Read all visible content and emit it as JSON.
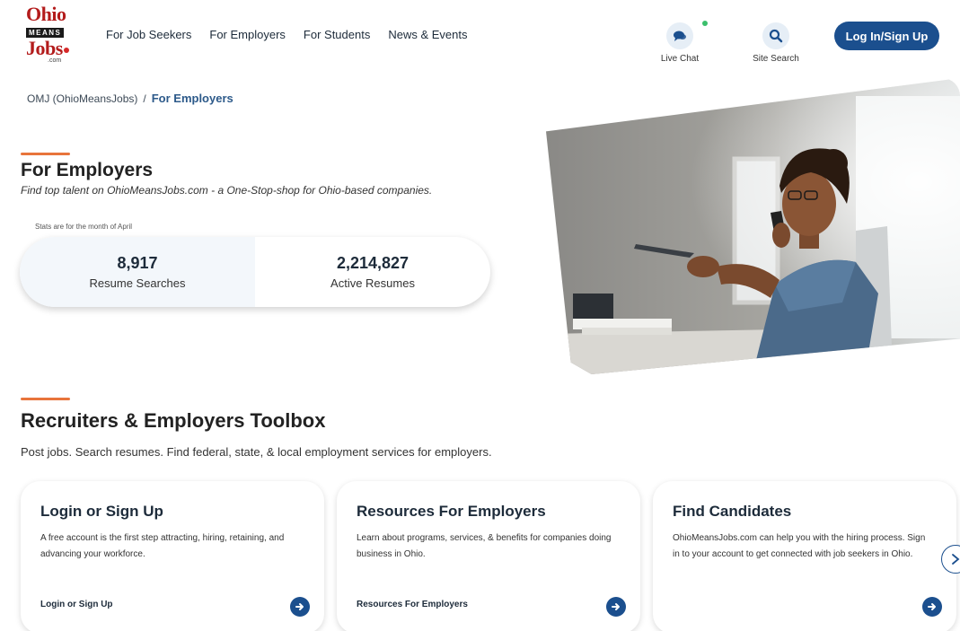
{
  "logo": {
    "line1": "Ohio",
    "line2": "MEANS",
    "line3": "Jobs",
    "line4": ".com"
  },
  "nav": [
    {
      "label": "For Job Seekers"
    },
    {
      "label": "For Employers"
    },
    {
      "label": "For Students"
    },
    {
      "label": "News & Events"
    }
  ],
  "header_tools": {
    "live_chat": {
      "label": "Live Chat",
      "icon": "chat-icon"
    },
    "site_search": {
      "label": "Site Search",
      "icon": "search-icon"
    },
    "login_label": "Log In/Sign Up"
  },
  "breadcrumb": {
    "root": "OMJ (OhioMeansJobs)",
    "separator": "/",
    "current": "For Employers"
  },
  "hero": {
    "title": "For Employers",
    "subtitle": "Find top talent on OhioMeansJobs.com - a One-Stop-shop for Ohio-based companies.",
    "stats_note": "Stats are for the month of April",
    "stats": [
      {
        "value": "8,917",
        "label": "Resume Searches"
      },
      {
        "value": "2,214,827",
        "label": "Active Resumes"
      }
    ]
  },
  "toolbox": {
    "title": "Recruiters & Employers Toolbox",
    "subtitle": "Post jobs. Search resumes. Find federal, state, & local employment services for employers.",
    "cards": [
      {
        "title": "Login or Sign Up",
        "description": "A free account is the first step attracting, hiring, retaining, and advancing your workforce.",
        "link": "Login or Sign Up"
      },
      {
        "title": "Resources For Employers",
        "description": "Learn about programs, services, & benefits for companies doing business in Ohio.",
        "link": "Resources For Employers"
      },
      {
        "title": "Find Candidates",
        "description": "OhioMeansJobs.com can help you with the hiring process. Sign in to your account to get connected with job seekers in Ohio.",
        "link": ""
      }
    ]
  },
  "colors": {
    "primary": "#1b4f8e",
    "accent": "#e8743b",
    "brand_red": "#b31b1b",
    "online": "#3bbf6c"
  }
}
